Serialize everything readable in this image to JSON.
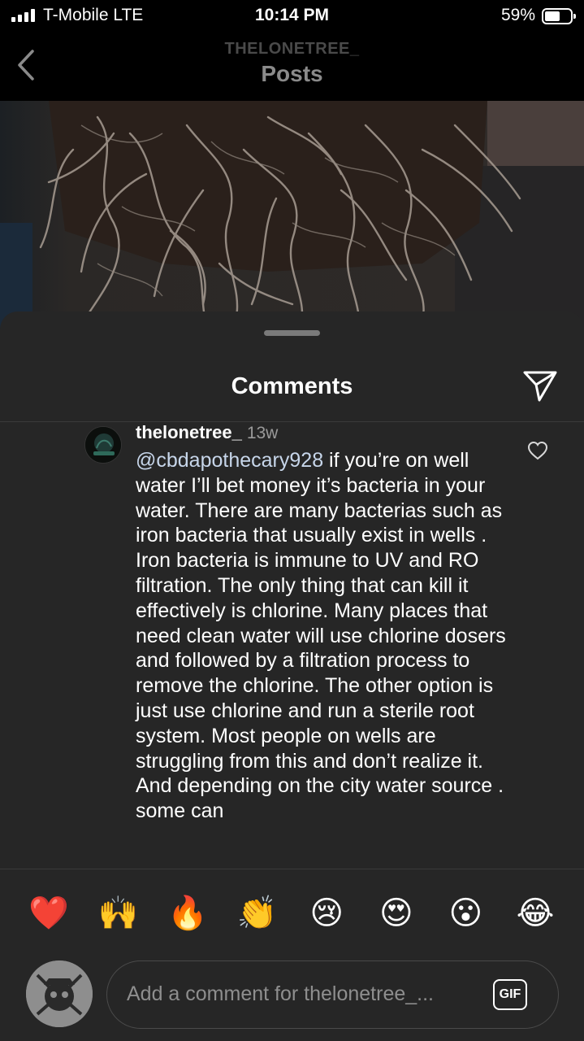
{
  "status_bar": {
    "carrier": "T-Mobile  LTE",
    "time": "10:14 PM",
    "battery_percent": "59%",
    "battery_level": 0.59,
    "signal_icon": "signal-bars-icon"
  },
  "nav": {
    "subtitle": "THELONETREE_",
    "title": "Posts",
    "back_icon": "chevron-left-icon"
  },
  "sheet": {
    "title": "Comments",
    "share_icon": "paper-plane-icon"
  },
  "comment": {
    "username": "thelonetree_",
    "time": "13w",
    "mention": "@cbdapothecary928",
    "text": " if you’re on well water I’ll bet money it’s bacteria in your water. There are many bacterias such as iron bacteria that usually exist in wells . Iron bacteria is immune to UV and RO filtration. The only thing that can kill it effectively is chlorine. Many places that need clean water will use chlorine dosers and followed by a filtration process to remove the chlorine. The other option is just use chlorine and run a sterile root system. Most people on wells are struggling from this and don’t realize it. And depending on the city water source . some can",
    "like_icon": "heart-outline-icon"
  },
  "emoji_bar": {
    "emojis": [
      "❤️",
      "🙌",
      "🔥",
      "👏",
      "😢",
      "😍",
      "😮",
      "😂"
    ]
  },
  "composer": {
    "placeholder": "Add a comment for thelonetree_...",
    "gif_label": "GIF"
  },
  "colors": {
    "sheet_bg": "#262626",
    "mention": "#c7d6ea",
    "muted": "#9a9a9a"
  }
}
